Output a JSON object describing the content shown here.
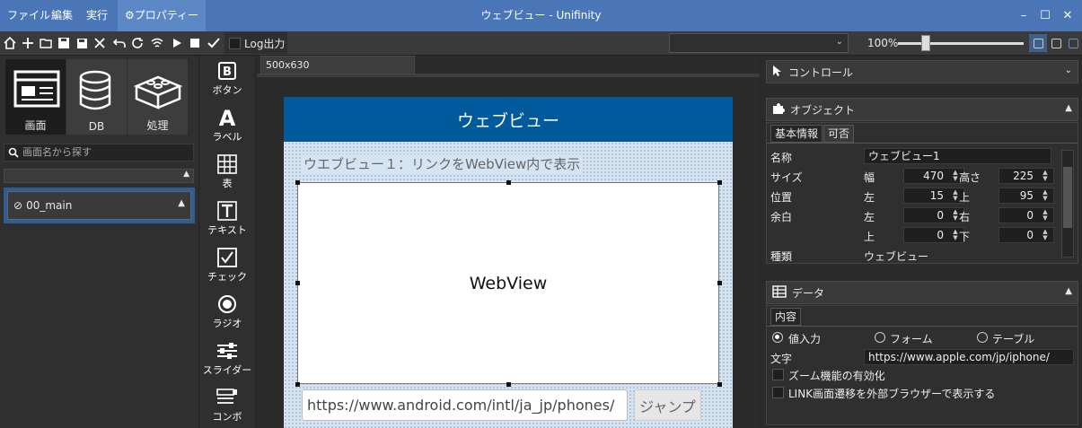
{
  "window": {
    "title": "ウェブビュー - Unifinity",
    "menu": [
      "ファイル",
      "編集",
      "実行",
      "プロパティー"
    ],
    "controls": {
      "minimize": "–",
      "maximize": "☐",
      "close": "✕"
    }
  },
  "toolbar": {
    "icons": [
      "home-icon",
      "plus-icon",
      "folder-icon",
      "save-icon",
      "save-all-icon",
      "close-icon",
      "undo-icon",
      "refresh-icon",
      "wifi-icon",
      "play-icon",
      "stop-icon",
      "check-icon"
    ],
    "log_label": "Log出力",
    "combo_value": "",
    "zoom": "100%",
    "zoom_slider_fraction": 0.22
  },
  "left": {
    "categories": [
      {
        "label": "画面",
        "icon": "screen-icon"
      },
      {
        "label": "DB",
        "icon": "database-icon"
      },
      {
        "label": "処理",
        "icon": "blocks-icon"
      }
    ],
    "search_placeholder": "画面名から探す",
    "screen_item": "00_main"
  },
  "palette": [
    {
      "label": "ボタン",
      "icon": "button-icon"
    },
    {
      "label": "ラベル",
      "icon": "label-icon"
    },
    {
      "label": "表",
      "icon": "table-icon"
    },
    {
      "label": "テキスト",
      "icon": "text-icon"
    },
    {
      "label": "チェック",
      "icon": "checkbox-icon"
    },
    {
      "label": "ラジオ",
      "icon": "radio-icon"
    },
    {
      "label": "スライダー",
      "icon": "slider-icon"
    },
    {
      "label": "コンボ",
      "icon": "combo-icon"
    }
  ],
  "canvas": {
    "tab": "500x630",
    "app_header": "ウェブビュー",
    "caption": "ウエブビュー１：リンクをWebView内で表示",
    "webview": "WebView",
    "url": "https://www.android.com/intl/ja_jp/phones/",
    "jump_button": "ジャンプ"
  },
  "right": {
    "control": "コントロール",
    "object": {
      "header": "オブジェクト",
      "tabs": [
        "基本情報",
        "可否"
      ],
      "name_label": "名称",
      "name_value": "ウェブビュー1",
      "size_label": "サイズ",
      "width_label": "幅",
      "width": "470",
      "height_label": "高さ",
      "height": "225",
      "pos_label": "位置",
      "left_label": "左",
      "left": "15",
      "top_label": "上",
      "top": "95",
      "margin_label": "余白",
      "m_left_label": "左",
      "m_left": "0",
      "m_right_label": "右",
      "m_right": "0",
      "m_top_label": "上",
      "m_top": "0",
      "m_bottom_label": "下",
      "m_bottom": "0",
      "type_label": "種類",
      "type_value": "ウェブビュー"
    },
    "data": {
      "header": "データ",
      "tab": "内容",
      "radios": [
        "値入力",
        "フォーム",
        "テーブル"
      ],
      "text_label": "文字",
      "text_value": "https://www.apple.com/jp/iphone/",
      "check1": "ズーム機能の有効化",
      "check2": "LINK画面遷移を外部ブラウザーで表示する"
    }
  },
  "colors": {
    "titlebar": "#4a76b8",
    "app_header": "#005a9c",
    "selection": "#2f5f92"
  }
}
